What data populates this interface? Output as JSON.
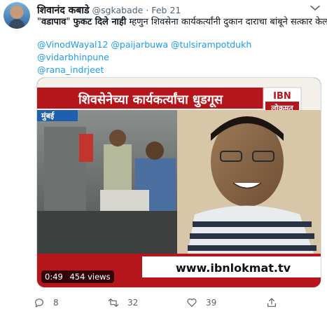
{
  "tweet": {
    "display_name": "शिवानंद कबाडे",
    "handle": "@sgkabade",
    "separator": "·",
    "date": "Feb 21",
    "text_prefix": "\"",
    "text_bold1": "वडापाव",
    "text_mid": "\" ",
    "text_bold2": "फुकट दिले नाही",
    "text_rest": " म्हणुन शिवसेना कार्यकर्त्यांनी दुकान दाराचा बांबूने सत्कार केला",
    "mentions_line1": [
      "@VinodWayal12",
      "@paijarbuwa",
      "@tulsirampotdukh"
    ],
    "mentions_line2": "@vidarbhinpune",
    "mentions_line3": "@rana_indrjeet"
  },
  "media": {
    "headline": "शिवसेनेच्या कार्यकर्त्यांचा धुडगूस",
    "location": "मुंबई",
    "channel_logo_top": "IBN",
    "channel_logo_bottom": "लोकमत",
    "website": "www.ibnlokmat.tv",
    "duration": "0:49",
    "views": "454 views"
  },
  "actions": {
    "replies": "8",
    "retweets": "32",
    "likes": "39"
  },
  "colors": {
    "link": "#1d9bf0",
    "muted": "#536471",
    "banner_red": "#b5161b"
  }
}
